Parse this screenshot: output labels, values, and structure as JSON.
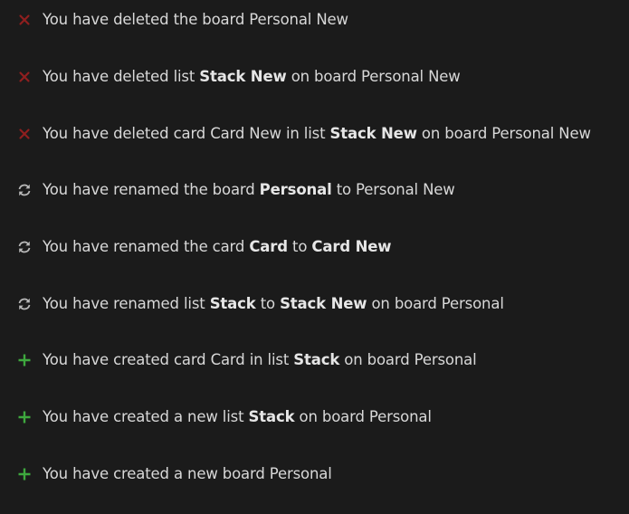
{
  "colors": {
    "background": "#1b1b1b",
    "text": "#d8d8d8",
    "delete_icon": "#8f1f1f",
    "rename_icon": "#b8b8b8",
    "create_icon": "#3ea83e"
  },
  "activities": [
    {
      "icon": "delete-icon",
      "segments": [
        {
          "text": "You have deleted the board Personal New",
          "bold": false
        }
      ]
    },
    {
      "icon": "delete-icon",
      "segments": [
        {
          "text": "You have deleted list ",
          "bold": false
        },
        {
          "text": "Stack New",
          "bold": true
        },
        {
          "text": " on board Personal New",
          "bold": false
        }
      ]
    },
    {
      "icon": "delete-icon",
      "segments": [
        {
          "text": "You have deleted card Card New in list ",
          "bold": false
        },
        {
          "text": "Stack New",
          "bold": true
        },
        {
          "text": " on board Personal New",
          "bold": false
        }
      ]
    },
    {
      "icon": "rename-icon",
      "segments": [
        {
          "text": "You have renamed the board ",
          "bold": false
        },
        {
          "text": "Personal",
          "bold": true
        },
        {
          "text": " to Personal New",
          "bold": false
        }
      ]
    },
    {
      "icon": "rename-icon",
      "segments": [
        {
          "text": "You have renamed the card ",
          "bold": false
        },
        {
          "text": "Card",
          "bold": true
        },
        {
          "text": " to ",
          "bold": false
        },
        {
          "text": "Card New",
          "bold": true
        }
      ]
    },
    {
      "icon": "rename-icon",
      "segments": [
        {
          "text": "You have renamed list ",
          "bold": false
        },
        {
          "text": "Stack",
          "bold": true
        },
        {
          "text": " to ",
          "bold": false
        },
        {
          "text": "Stack New",
          "bold": true
        },
        {
          "text": " on board Personal",
          "bold": false
        }
      ]
    },
    {
      "icon": "create-icon",
      "segments": [
        {
          "text": "You have created card Card in list ",
          "bold": false
        },
        {
          "text": "Stack",
          "bold": true
        },
        {
          "text": " on board Personal",
          "bold": false
        }
      ]
    },
    {
      "icon": "create-icon",
      "segments": [
        {
          "text": "You have created a new list ",
          "bold": false
        },
        {
          "text": "Stack",
          "bold": true
        },
        {
          "text": " on board Personal",
          "bold": false
        }
      ]
    },
    {
      "icon": "create-icon",
      "segments": [
        {
          "text": "You have created a new board Personal",
          "bold": false
        }
      ]
    }
  ]
}
